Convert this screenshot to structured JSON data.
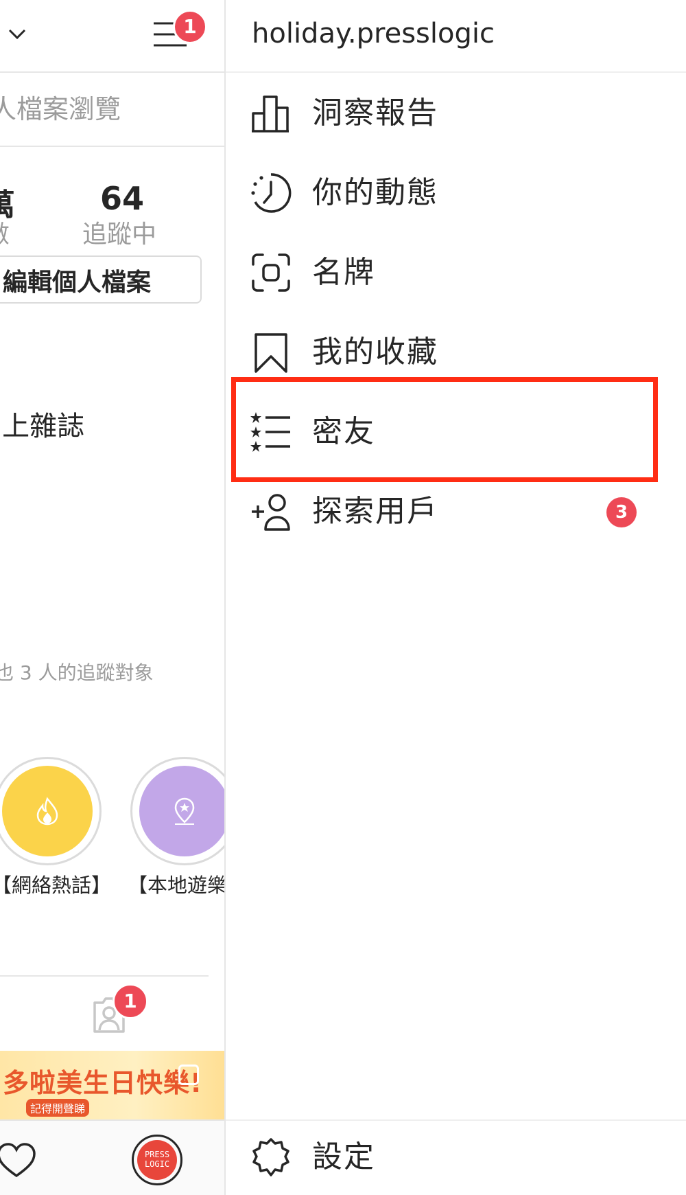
{
  "left_panel": {
    "profile_views_partial": "人檔案瀏覽",
    "stat_left_value_partial": "萬",
    "stat_left_label_partial": "數",
    "following_count": "64",
    "following_label": "追蹤中",
    "edit_profile_partial": "編輯個人檔案",
    "bio_partial": "l上雜誌",
    "followed_by_partial": "也 3 人的追蹤對象",
    "highlights": [
      {
        "label": "【網絡熱話】",
        "color": "#fbd34a"
      },
      {
        "label": "【本地遊樂",
        "color": "#c2a7e8"
      }
    ],
    "menu_badge": "1",
    "tagged_badge": "1",
    "thumb_text_big": "多啦美生日快樂!",
    "thumb_text_small": "記得開聲睇",
    "avatar_text_1": "PRESS",
    "avatar_text_2": "LOGIC"
  },
  "drawer": {
    "username": "holiday.presslogic",
    "menu": [
      {
        "label": "洞察報告",
        "icon": "bar-chart-icon"
      },
      {
        "label": "你的動態",
        "icon": "activity-clock-icon"
      },
      {
        "label": "名牌",
        "icon": "nametag-scan-icon"
      },
      {
        "label": "我的收藏",
        "icon": "bookmark-icon"
      },
      {
        "label": "密友",
        "icon": "close-friends-star-list-icon"
      },
      {
        "label": "探索用戶",
        "icon": "add-user-icon",
        "badge": "3"
      }
    ],
    "settings_label": "設定"
  },
  "colors": {
    "badge": "#ed4956",
    "highlight_border": "#ff2d14",
    "text": "#262626",
    "muted": "#9b9b9b"
  }
}
